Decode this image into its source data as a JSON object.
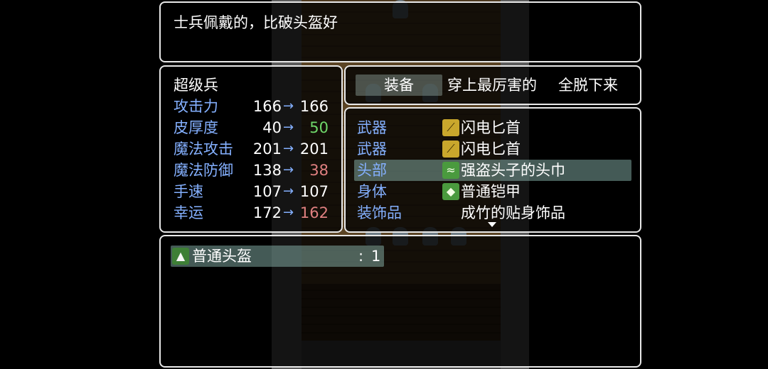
{
  "help": {
    "description": "士兵佩戴的，比破头盔好"
  },
  "status": {
    "actor_name": "超级兵",
    "arrow": "→",
    "params": [
      {
        "label": "攻击力",
        "current": "166",
        "new": "166",
        "change": "same"
      },
      {
        "label": "皮厚度",
        "current": "40",
        "new": "50",
        "change": "up"
      },
      {
        "label": "魔法攻击",
        "current": "201",
        "new": "201",
        "change": "same"
      },
      {
        "label": "魔法防御",
        "current": "138",
        "new": "38",
        "change": "down"
      },
      {
        "label": "手速",
        "current": "107",
        "new": "107",
        "change": "same"
      },
      {
        "label": "幸运",
        "current": "172",
        "new": "162",
        "change": "down"
      }
    ]
  },
  "commands": {
    "selected_index": 0,
    "items": [
      "装备",
      "穿上最厉害的",
      "全脱下来"
    ]
  },
  "slots": {
    "selected_index": 2,
    "items": [
      {
        "type": "武器",
        "icon": "dagger-icon",
        "item": "闪电匕首"
      },
      {
        "type": "武器",
        "icon": "dagger-icon",
        "item": "闪电匕首"
      },
      {
        "type": "头部",
        "icon": "bandana-icon",
        "item": "强盗头子的头巾"
      },
      {
        "type": "身体",
        "icon": "armor-icon",
        "item": "普通铠甲"
      },
      {
        "type": "装饰品",
        "icon": "",
        "item": "成竹的贴身饰品"
      }
    ]
  },
  "items": {
    "list": [
      {
        "icon": "helmet-icon",
        "name": "普通头盔",
        "count_prefix": ":",
        "count": "1"
      }
    ]
  },
  "colors": {
    "system_text": "#84b0ff",
    "power_up": "#6fd86a",
    "power_down": "#e08080",
    "window_border": "#e8e8e8"
  }
}
